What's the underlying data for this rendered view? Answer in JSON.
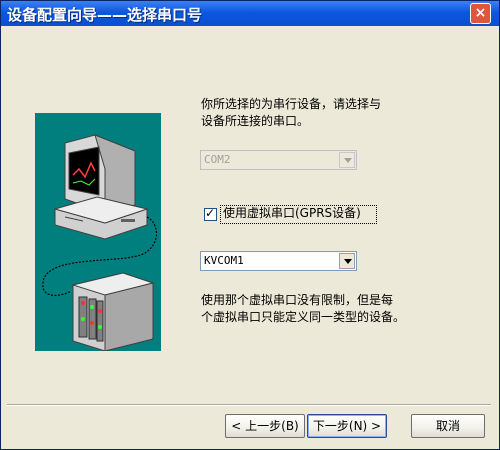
{
  "window": {
    "title": "设备配置向导——选择串口号",
    "close_label": "×"
  },
  "intro": {
    "line1": "你所选择的为串行设备，请选择与",
    "line2": "设备所连接的串口。"
  },
  "port_select": {
    "value": "COM2",
    "enabled": false
  },
  "virtual_port": {
    "checked": true,
    "label": "使用虚拟串口(GPRS设备)"
  },
  "virtual_select": {
    "value": "KVCOM1"
  },
  "note": {
    "line1": "使用那个虚拟串口没有限制，但是每",
    "line2": "个虚拟串口只能定义同一类型的设备。"
  },
  "buttons": {
    "back": "< 上一步(B)",
    "next": "下一步(N) >",
    "cancel": "取消"
  },
  "colors": {
    "title_bar": "#0b57e0",
    "illustration_bg": "#007f7f",
    "dialog_bg": "#ece9d8"
  }
}
